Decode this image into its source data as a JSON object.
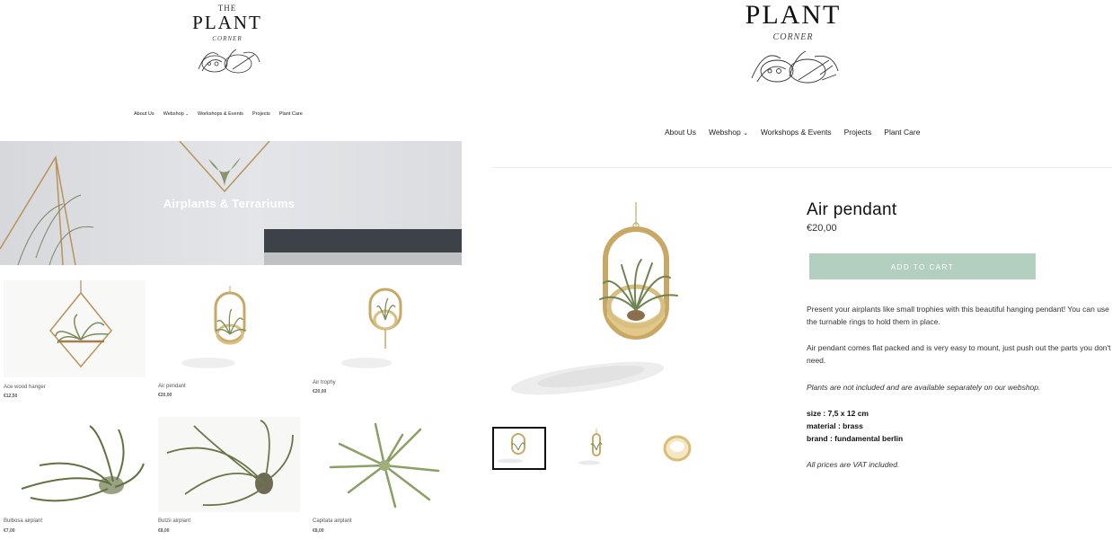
{
  "left_page": {
    "logo": {
      "the": "THE",
      "word": "PLANT",
      "corner": "CORNER"
    },
    "nav": [
      {
        "label": "About Us"
      },
      {
        "label": "Webshop",
        "chevron": "⌄"
      },
      {
        "label": "Workshops & Events"
      },
      {
        "label": "Projects"
      },
      {
        "label": "Plant Care"
      }
    ],
    "hero_title": "Airplants & Terrariums",
    "products": [
      {
        "name": "Ace wood hanger",
        "price": "€12,50"
      },
      {
        "name": "Air pendant",
        "price": "€20,00"
      },
      {
        "name": "Air trophy",
        "price": "€20,00"
      },
      {
        "name": "Bulbosa airplant",
        "price": "€7,00"
      },
      {
        "name": "Butzii airplant",
        "price": "€8,00"
      },
      {
        "name": "Capitata airplant",
        "price": "€8,00"
      }
    ]
  },
  "right_page": {
    "logo": {
      "word": "PLANT",
      "corner": "CORNER"
    },
    "nav": [
      {
        "label": "About Us"
      },
      {
        "label": "Webshop",
        "chevron": "⌄"
      },
      {
        "label": "Workshops & Events"
      },
      {
        "label": "Projects"
      },
      {
        "label": "Plant Care"
      }
    ],
    "product": {
      "title": "Air pendant",
      "price": "€20,00",
      "add_to_cart": "ADD TO CART",
      "description_1": "Present your airplants like small trophies with this beautiful hanging pendant! You can use the turnable rings to hold them in place.",
      "description_2": "Air pendant comes flat packed and is very easy to mount, just push out the parts you don't need.",
      "note": "Plants are not included and are available separately on our webshop.",
      "specs": [
        "size : 7,5 x 12 cm",
        "material : brass",
        "brand : fundamental berlin"
      ],
      "vat_note": "All prices are VAT included."
    }
  },
  "colors": {
    "accent": "#b3cfc0",
    "brass": "#c9a865",
    "plant": "#7a8c5a"
  }
}
